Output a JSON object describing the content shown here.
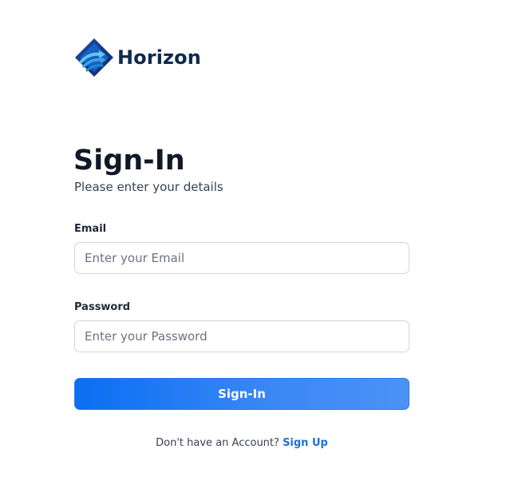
{
  "brand": {
    "name": "Horizon",
    "logo_icon": "horizon-logo-icon"
  },
  "header": {
    "title": "Sign-In",
    "subtitle": "Please enter your details"
  },
  "form": {
    "email": {
      "label": "Email",
      "placeholder": "Enter your Email",
      "value": ""
    },
    "password": {
      "label": "Password",
      "placeholder": "Enter your Password",
      "value": ""
    },
    "submit_label": "Sign-In"
  },
  "footer": {
    "prompt": "Don't have an Account?",
    "signup_link": "Sign Up"
  },
  "colors": {
    "primary": "#0a6ff2",
    "brand_text": "#0f2a4d",
    "link": "#1e6fd9"
  }
}
